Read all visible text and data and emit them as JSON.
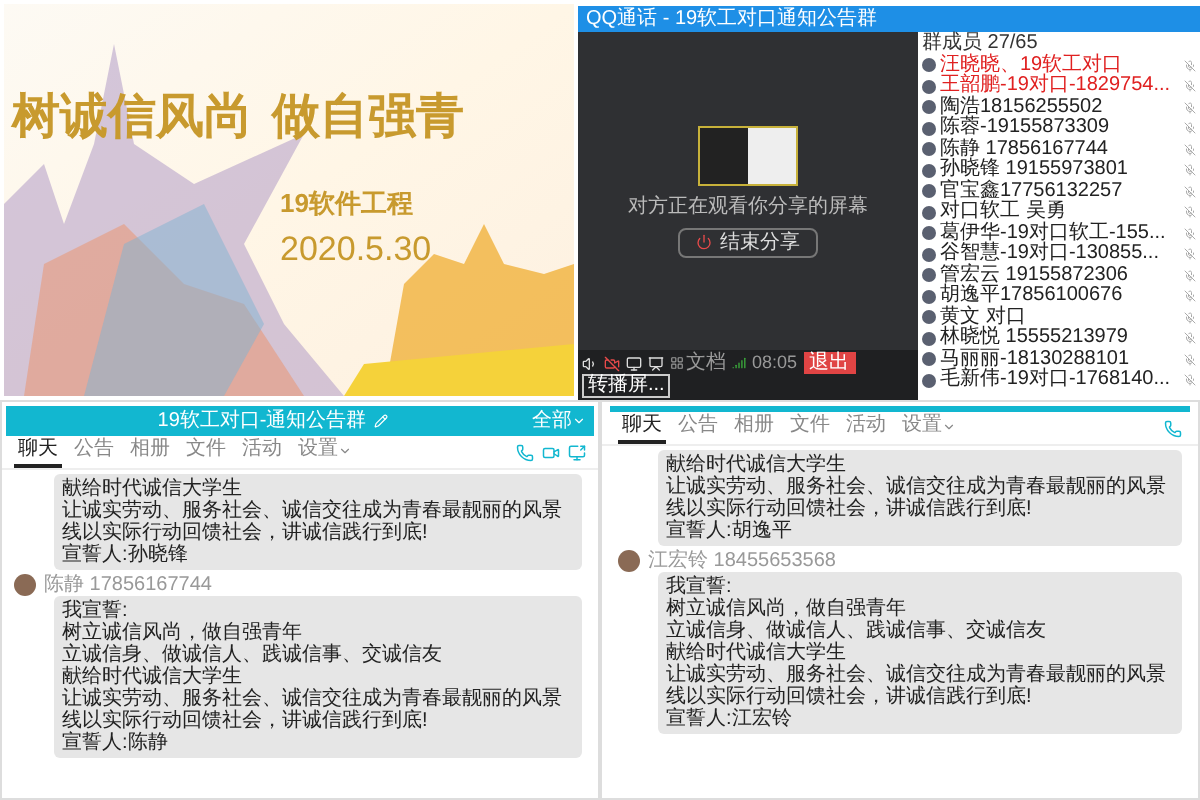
{
  "poster": {
    "headline_1": "树诚信风尚",
    "headline_2": "做自强青",
    "subtitle": "19软件工程",
    "date": "2020.5.30"
  },
  "call_window": {
    "title": "QQ通话 - 19软工对口通知公告群",
    "status": "对方正在观看你分享的屏幕",
    "end_share_button": "结束分享",
    "document_button": "文档",
    "call_time": "08:05",
    "exit_button": "退出",
    "switch_button": "转播屏...",
    "members_header": "群成员 27/65",
    "members": [
      {
        "name": "汪晓晓、19软工对口",
        "highlighted": true
      },
      {
        "name": "王韶鹏-19对口-1829754...",
        "highlighted": true
      },
      {
        "name": "陶浩18156255502",
        "highlighted": false
      },
      {
        "name": "陈蓉-19155873309",
        "highlighted": false
      },
      {
        "name": "陈静 17856167744",
        "highlighted": false
      },
      {
        "name": "孙晓锋 19155973801",
        "highlighted": false
      },
      {
        "name": "官宝鑫17756132257",
        "highlighted": false
      },
      {
        "name": "对口软工 吴勇",
        "highlighted": false
      },
      {
        "name": "葛伊华-19对口软工-155...",
        "highlighted": false
      },
      {
        "name": "谷智慧-19对口-130855...",
        "highlighted": false
      },
      {
        "name": "管宏云 19155872306",
        "highlighted": false
      },
      {
        "name": "胡逸平17856100676",
        "highlighted": false
      },
      {
        "name": "黄文 对口",
        "highlighted": false
      },
      {
        "name": "林晓悦 15555213979",
        "highlighted": false
      },
      {
        "name": "马丽丽-18130288101",
        "highlighted": false
      },
      {
        "name": "毛新伟-19对口-1768140...",
        "highlighted": false
      }
    ]
  },
  "chat_left": {
    "title": "19软工对口-通知公告群",
    "menu_label": "全部",
    "tabs": [
      {
        "label": "聊天",
        "selected": true
      },
      {
        "label": "公告",
        "selected": false
      },
      {
        "label": "相册",
        "selected": false
      },
      {
        "label": "文件",
        "selected": false
      },
      {
        "label": "活动",
        "selected": false
      },
      {
        "label": "设置",
        "selected": false
      }
    ],
    "messages": [
      {
        "lines": [
          "献给时代诚信大学生",
          "让诚实劳动、服务社会、诚信交往成为青春最靓丽的风景线以实际行动回馈社会，讲诚信践行到底!",
          "宣誓人:孙晓锋"
        ]
      },
      {
        "sender": "陈静 17856167744",
        "lines": [
          "我宣誓:",
          "树立诚信风尚，做自强青年",
          "立诚信身、做诚信人、践诚信事、交诚信友",
          "献给时代诚信大学生",
          "让诚实劳动、服务社会、诚信交往成为青春最靓丽的风景线以实际行动回馈社会，讲诚信践行到底!",
          "宣誓人:陈静"
        ]
      }
    ]
  },
  "chat_right": {
    "tabs": [
      {
        "label": "聊天",
        "selected": true
      },
      {
        "label": "公告",
        "selected": false
      },
      {
        "label": "相册",
        "selected": false
      },
      {
        "label": "文件",
        "selected": false
      },
      {
        "label": "活动",
        "selected": false
      },
      {
        "label": "设置",
        "selected": false
      }
    ],
    "messages": [
      {
        "lines": [
          "献给时代诚信大学生",
          "让诚实劳动、服务社会、诚信交往成为青春最靓丽的风景线以实际行动回馈社会，讲诚信践行到底!",
          "宣誓人:胡逸平"
        ]
      },
      {
        "sender": "江宏铃 18455653568",
        "lines": [
          "我宣誓:",
          "树立诚信风尚，做自强青年",
          "立诚信身、做诚信人、践诚信事、交诚信友",
          "献给时代诚信大学生",
          "让诚实劳动、服务社会、诚信交往成为青春最靓丽的风景线以实际行动回馈社会，讲诚信践行到底!",
          "宣誓人:江宏铃"
        ]
      }
    ]
  }
}
